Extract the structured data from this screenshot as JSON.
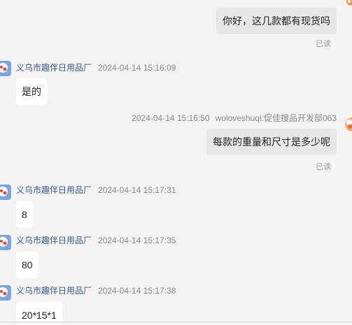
{
  "messages": [
    {
      "direction": "out",
      "text": "你好，这几款都有现货吗",
      "status": "已读"
    },
    {
      "direction": "in",
      "sender": "义乌市趣伴日用品厂",
      "time": "2024-04-14 15:16:09",
      "text": "是的"
    },
    {
      "direction": "out",
      "sender": "woloveshuqi:促佳搜品开发部063",
      "time": "2024-04-14 15:16:50",
      "text": "每款的重量和尺寸是多少呢",
      "status": "已读"
    },
    {
      "direction": "in",
      "sender": "义乌市趣伴日用品厂",
      "time": "2024-04-14 15:17:31",
      "text": "8"
    },
    {
      "direction": "in",
      "sender": "义乌市趣伴日用品厂",
      "time": "2024-04-14 15:17:35",
      "text": "80"
    },
    {
      "direction": "in",
      "sender": "义乌市趣伴日用品厂",
      "time": "2024-04-14 15:17:38",
      "text": "20*15*1"
    }
  ],
  "colors": {
    "background": "#f3f3f3",
    "incoming_bubble": "#ffffff",
    "outgoing_bubble": "#e7e7e7",
    "sender_name": "#3b5a85",
    "meta_text": "#8a8a8a"
  },
  "icons": {
    "seller_avatar": "cartoon-avatar-icon",
    "buyer_avatar": "cartoon-avatar-icon"
  }
}
